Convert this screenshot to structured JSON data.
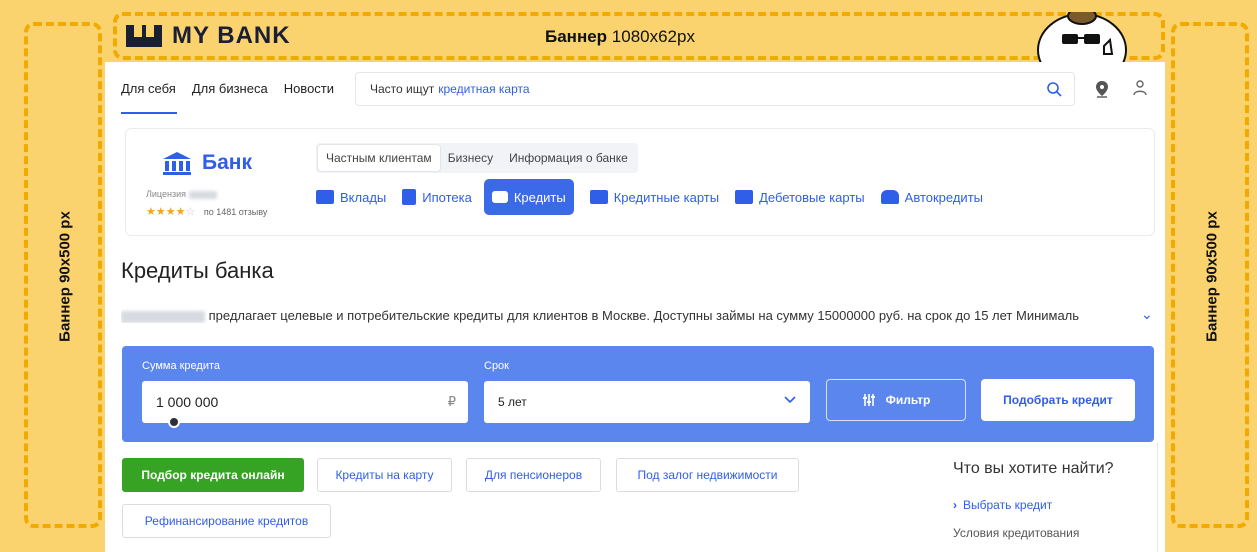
{
  "top_banner": {
    "logo_text": "MY BANK",
    "label_bold": "Баннер",
    "label_rest": " 1080x62px"
  },
  "side_banners": {
    "left_label": "Баннер 90x500 px",
    "right_label": "Баннер 90x500 px"
  },
  "topnav": {
    "links": [
      "Для себя",
      "Для бизнеса",
      "Новости"
    ],
    "search_prefix": "Часто ищут",
    "search_query": "кредитная карта"
  },
  "bank": {
    "name": "Банк",
    "license_label": "Лицензия",
    "rating_stars": "★★★★",
    "rating_empty_star": "☆",
    "reviews": "по 1481 отзыву",
    "segment_tabs": [
      "Частным клиентам",
      "Бизнесу",
      "Информация о банке"
    ],
    "product_tabs": [
      "Вклады",
      "Ипотека",
      "Кредиты",
      "Кредитные карты",
      "Дебетовые карты",
      "Автокредиты"
    ]
  },
  "main": {
    "title": "Кредиты банка",
    "description": "предлагает целевые и потребительские кредиты для клиентов в Москве. Доступны займы на сумму 15000000 руб. на срок до 15 лет Минималь",
    "expand_chevron": "⌄"
  },
  "calculator": {
    "amount_label": "Сумма кредита",
    "amount_value": "1 000 000",
    "amount_suffix": "₽",
    "term_label": "Срок",
    "term_value": "5 лет",
    "filter_label": "Фильтр",
    "pick_label": "Подобрать кредит"
  },
  "chips": [
    "Подбор кредита онлайн",
    "Кредиты на карту",
    "Для пенсионеров",
    "Под залог недвижимости",
    "Рефинансирование кредитов"
  ],
  "right_panel": {
    "heading": "Что вы хотите найти?",
    "link": "Выбрать кредит",
    "link_arrow": "›",
    "subtext": "Условия кредитования"
  },
  "colors": {
    "background": "#fad36f",
    "dash": "#f2a900",
    "accent": "#2f5ee8",
    "calc_bg": "#5b86ed",
    "primary_chip": "#37a325"
  }
}
